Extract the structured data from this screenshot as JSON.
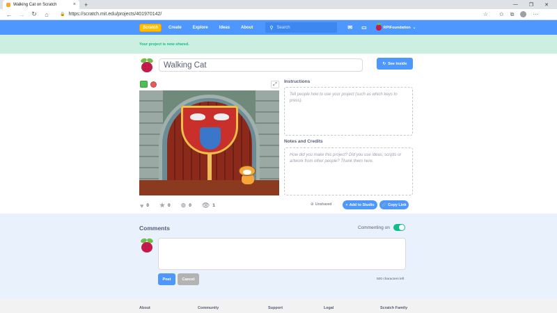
{
  "browser": {
    "tab_title": "Walking Cat on Scratch",
    "tab_close": "×",
    "new_tab": "+",
    "window_controls": [
      "—",
      "❐",
      "✕"
    ],
    "url": "https://scratch.mit.edu/projects/401970142/"
  },
  "nav": {
    "logo_text": "Scratch",
    "links": [
      "Create",
      "Explore",
      "Ideas",
      "About"
    ],
    "search_placeholder": "Search",
    "username": "RPiFoundation"
  },
  "banner": {
    "message": "Your project is now shared."
  },
  "project": {
    "title": "Walking Cat",
    "see_inside_label": "See inside",
    "instructions_label": "Instructions",
    "instructions_placeholder": "Tell people how to use your project (such as which keys to press).",
    "notes_label": "Notes and Credits",
    "notes_placeholder": "How did you make this project? Did you use ideas, scripts or artwork from other people? Thank them here.",
    "stats": {
      "loves": "0",
      "favorites": "0",
      "remixes": "0",
      "views": "1"
    },
    "unshared_label": "Unshared",
    "add_to_studio_label": "Add to Studio",
    "copy_link_label": "Copy Link"
  },
  "comments": {
    "title": "Comments",
    "commenting_label": "Commenting on",
    "post_label": "Post",
    "cancel_label": "Cancel",
    "chars_left": "500 characters left"
  },
  "footer": {
    "columns": [
      "About",
      "Community",
      "Support",
      "Legal",
      "Scratch Family"
    ]
  },
  "colors": {
    "scratch_blue": "#4d97ff",
    "banner_green_bg": "#cbf0e2",
    "banner_green_text": "#0fbd8c",
    "comments_bg": "#e9f1fc"
  }
}
